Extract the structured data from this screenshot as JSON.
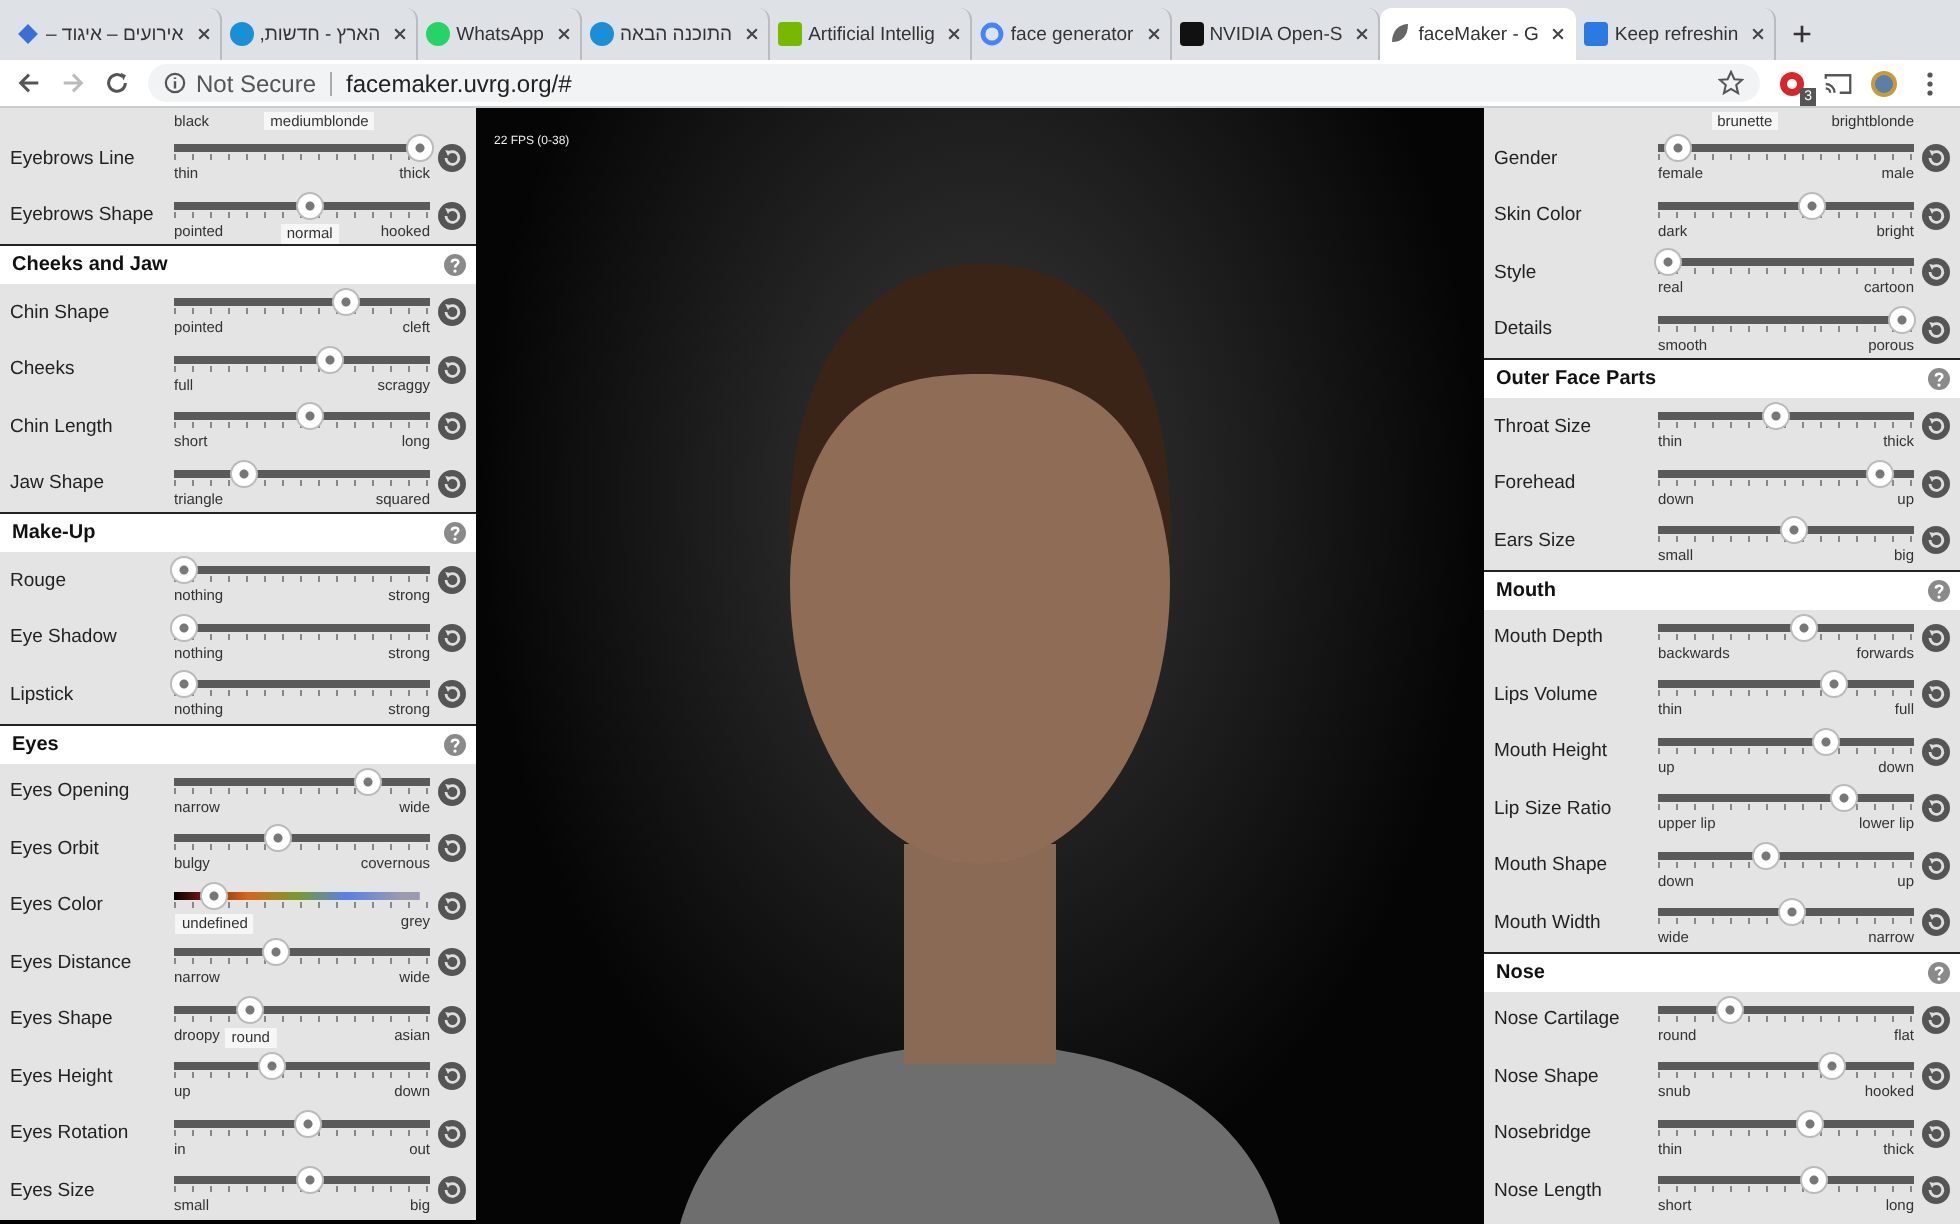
{
  "browser": {
    "tabs": [
      {
        "title": "אירועים – איגוד –",
        "selected": false
      },
      {
        "title": "הארץ - חדשות,",
        "selected": false
      },
      {
        "title": "WhatsApp",
        "selected": false
      },
      {
        "title": "התוכנה הבאה",
        "selected": false
      },
      {
        "title": "Artificial Intellig",
        "selected": false
      },
      {
        "title": "face generator",
        "selected": false
      },
      {
        "title": "NVIDIA Open-S",
        "selected": false
      },
      {
        "title": "faceMaker - G",
        "selected": true
      },
      {
        "title": "Keep refreshin",
        "selected": false
      }
    ],
    "security": "Not Secure",
    "url": "facemaker.uvrg.org/#",
    "extension_badge": "3"
  },
  "viewport": {
    "fps": "22 FPS (0-38)"
  },
  "left_panel": {
    "items": [
      {
        "kind": "cut",
        "min": "black",
        "tag": "mediumblonde"
      },
      {
        "kind": "slider",
        "label": "Eyebrows Line",
        "min": "thin",
        "max": "thick",
        "level": 0.96
      },
      {
        "kind": "slider",
        "label": "Eyebrows Shape",
        "min": "pointed",
        "max": "hooked",
        "level": 0.53,
        "tag": "normal"
      },
      {
        "kind": "header",
        "title": "Cheeks and Jaw"
      },
      {
        "kind": "slider",
        "label": "Chin Shape",
        "min": "pointed",
        "max": "cleft",
        "level": 0.67
      },
      {
        "kind": "slider",
        "label": "Cheeks",
        "min": "full",
        "max": "scraggy",
        "level": 0.61
      },
      {
        "kind": "slider",
        "label": "Chin Length",
        "min": "short",
        "max": "long",
        "level": 0.53
      },
      {
        "kind": "slider",
        "label": "Jaw Shape",
        "min": "triangle",
        "max": "squared",
        "level": 0.27
      },
      {
        "kind": "header",
        "title": "Make-Up"
      },
      {
        "kind": "slider",
        "label": "Rouge",
        "min": "nothing",
        "max": "strong",
        "level": 0.04
      },
      {
        "kind": "slider",
        "label": "Eye Shadow",
        "min": "nothing",
        "max": "strong",
        "level": 0.04
      },
      {
        "kind": "slider",
        "label": "Lipstick",
        "min": "nothing",
        "max": "strong",
        "level": 0.04
      },
      {
        "kind": "header",
        "title": "Eyes"
      },
      {
        "kind": "slider",
        "label": "Eyes Opening",
        "min": "narrow",
        "max": "wide",
        "level": 0.76
      },
      {
        "kind": "slider",
        "label": "Eyes Orbit",
        "min": "bulgy",
        "max": "covernous",
        "level": 0.41
      },
      {
        "kind": "color-slider",
        "label": "Eyes Color",
        "max": "grey",
        "level": 0.16,
        "tag": "undefined"
      },
      {
        "kind": "slider",
        "label": "Eyes Distance",
        "min": "narrow",
        "max": "wide",
        "level": 0.4
      },
      {
        "kind": "slider",
        "label": "Eyes Shape",
        "min": "droopy",
        "max": "asian",
        "level": 0.3,
        "tag": "round"
      },
      {
        "kind": "slider",
        "label": "Eyes Height",
        "min": "up",
        "max": "down",
        "level": 0.38
      },
      {
        "kind": "slider",
        "label": "Eyes Rotation",
        "min": "in",
        "max": "out",
        "level": 0.52
      },
      {
        "kind": "slider",
        "label": "Eyes Size",
        "min": "small",
        "max": "big",
        "level": 0.53
      }
    ]
  },
  "right_panel": {
    "items": [
      {
        "kind": "cut",
        "max": "brightblonde",
        "tag": "brunette"
      },
      {
        "kind": "slider",
        "label": "Gender",
        "min": "female",
        "max": "male",
        "level": 0.08
      },
      {
        "kind": "slider",
        "label": "Skin Color",
        "min": "dark",
        "max": "bright",
        "level": 0.6
      },
      {
        "kind": "slider",
        "label": "Style",
        "min": "real",
        "max": "cartoon",
        "level": 0.04
      },
      {
        "kind": "slider",
        "label": "Details",
        "min": "smooth",
        "max": "porous",
        "level": 0.95
      },
      {
        "kind": "header",
        "title": "Outer Face Parts"
      },
      {
        "kind": "slider",
        "label": "Throat Size",
        "min": "thin",
        "max": "thick",
        "level": 0.46
      },
      {
        "kind": "slider",
        "label": "Forehead",
        "min": "down",
        "max": "up",
        "level": 0.87
      },
      {
        "kind": "slider",
        "label": "Ears Size",
        "min": "small",
        "max": "big",
        "level": 0.53
      },
      {
        "kind": "header",
        "title": "Mouth"
      },
      {
        "kind": "slider",
        "label": "Mouth Depth",
        "min": "backwards",
        "max": "forwards",
        "level": 0.57
      },
      {
        "kind": "slider",
        "label": "Lips Volume",
        "min": "thin",
        "max": "full",
        "level": 0.69
      },
      {
        "kind": "slider",
        "label": "Mouth Height",
        "min": "up",
        "max": "down",
        "level": 0.66
      },
      {
        "kind": "slider",
        "label": "Lip Size Ratio",
        "min": "upper lip",
        "max": "lower lip",
        "level": 0.73
      },
      {
        "kind": "slider",
        "label": "Mouth Shape",
        "min": "down",
        "max": "up",
        "level": 0.42
      },
      {
        "kind": "slider",
        "label": "Mouth Width",
        "min": "wide",
        "max": "narrow",
        "level": 0.52
      },
      {
        "kind": "header",
        "title": "Nose"
      },
      {
        "kind": "slider",
        "label": "Nose Cartilage",
        "min": "round",
        "max": "flat",
        "level": 0.28
      },
      {
        "kind": "slider",
        "label": "Nose Shape",
        "min": "snub",
        "max": "hooked",
        "level": 0.68
      },
      {
        "kind": "slider",
        "label": "Nosebridge",
        "min": "thin",
        "max": "thick",
        "level": 0.59
      },
      {
        "kind": "slider",
        "label": "Nose Length",
        "min": "short",
        "max": "long",
        "level": 0.61
      }
    ]
  }
}
